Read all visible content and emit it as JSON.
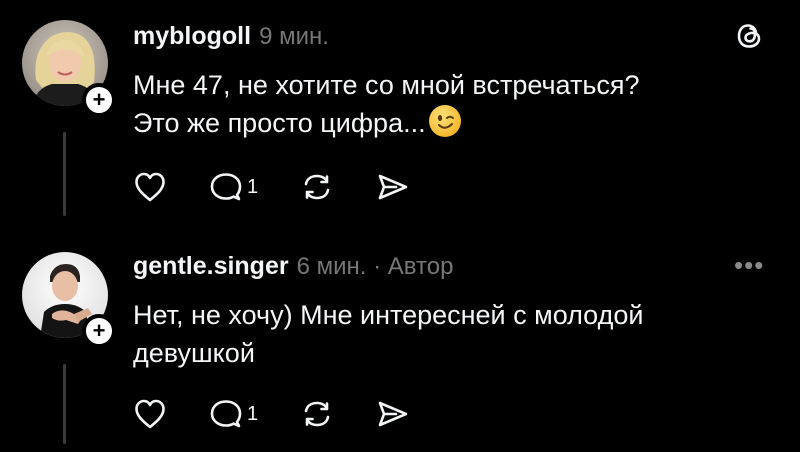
{
  "posts": [
    {
      "username": "myblogoll",
      "meta": "9 мин.",
      "text_line1": "Мне 47, не хотите со мной встречаться?",
      "text_line2": "Это же просто цифра...",
      "emoji": "wink-emoji",
      "reply_count": "1"
    },
    {
      "username": "gentle.singer",
      "meta": "6 мин. · Автор",
      "text_line1": "Нет, не хочу) Мне интересней с молодой",
      "text_line2": "девушкой",
      "reply_count": "1"
    }
  ],
  "icons": {
    "logo": "threads-logo-icon",
    "more": "more-dots-icon",
    "like": "heart-icon",
    "reply": "comment-icon",
    "repost": "repost-icon",
    "share": "send-icon",
    "follow": "plus-icon"
  },
  "more_glyph": "•••",
  "colors": {
    "background": "#000000",
    "text": "#f3f5f7",
    "muted": "#777777"
  }
}
